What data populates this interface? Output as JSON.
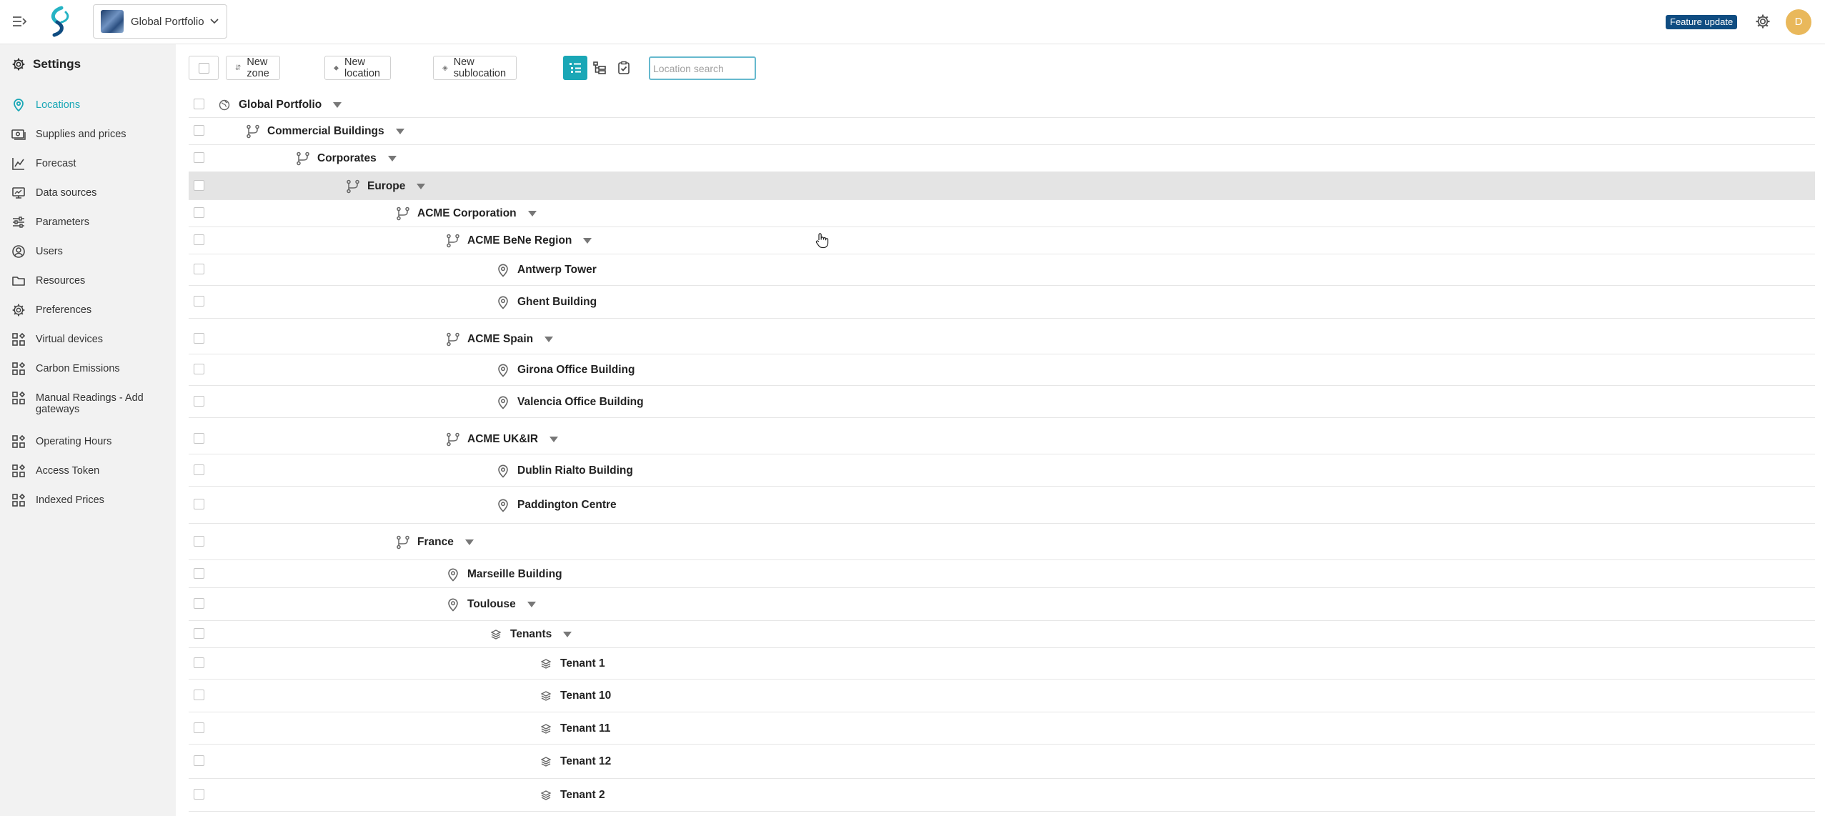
{
  "topbar": {
    "portfolio_label": "Global Portfolio",
    "feature_badge": "Feature update",
    "avatar_initial": "D"
  },
  "sidebar": {
    "title": "Settings",
    "items": [
      {
        "label": "Locations",
        "icon": "location-pin-icon",
        "active": true
      },
      {
        "label": "Supplies and prices",
        "icon": "supplies-icon"
      },
      {
        "label": "Forecast",
        "icon": "forecast-chart-icon"
      },
      {
        "label": "Data sources",
        "icon": "data-sources-icon"
      },
      {
        "label": "Parameters",
        "icon": "sliders-icon"
      },
      {
        "label": "Users",
        "icon": "user-icon"
      },
      {
        "label": "Resources",
        "icon": "folder-icon"
      },
      {
        "label": "Preferences",
        "icon": "gear-icon"
      },
      {
        "label": "Virtual devices",
        "icon": "widgets-icon"
      },
      {
        "label": "Carbon Emissions",
        "icon": "widgets-icon"
      },
      {
        "label": "Manual Readings - Add gateways",
        "icon": "widgets-icon"
      },
      {
        "label": "Operating Hours",
        "icon": "widgets-icon"
      },
      {
        "label": "Access Token",
        "icon": "widgets-icon"
      },
      {
        "label": "Indexed Prices",
        "icon": "widgets-icon"
      }
    ]
  },
  "toolbar": {
    "new_zone": "New zone",
    "new_location": "New location",
    "new_sublocation": "New sublocation",
    "search_placeholder": "Location search"
  },
  "tree": [
    {
      "label": "Global Portfolio",
      "type": "globe",
      "expandable": true
    },
    {
      "label": "Commercial Buildings",
      "type": "zone",
      "expandable": true
    },
    {
      "label": "Corporates",
      "type": "zone",
      "expandable": true
    },
    {
      "label": "Europe",
      "type": "zone",
      "expandable": true,
      "highlighted": true
    },
    {
      "label": "ACME Corporation",
      "type": "zone",
      "expandable": true
    },
    {
      "label": "ACME BeNe Region",
      "type": "zone",
      "expandable": true
    },
    {
      "label": "Antwerp Tower",
      "type": "location",
      "expandable": false
    },
    {
      "label": "Ghent Building",
      "type": "location",
      "expandable": false
    },
    {
      "label": "ACME Spain",
      "type": "zone",
      "expandable": true
    },
    {
      "label": "Girona Office Building",
      "type": "location",
      "expandable": false
    },
    {
      "label": "Valencia Office Building",
      "type": "location",
      "expandable": false
    },
    {
      "label": "ACME UK&IR",
      "type": "zone",
      "expandable": true
    },
    {
      "label": "Dublin Rialto Building",
      "type": "location",
      "expandable": false
    },
    {
      "label": "Paddington Centre",
      "type": "location",
      "expandable": false
    },
    {
      "label": "France",
      "type": "zone",
      "expandable": true
    },
    {
      "label": "Marseille Building",
      "type": "location",
      "expandable": false
    },
    {
      "label": "Toulouse",
      "type": "location",
      "expandable": true
    },
    {
      "label": "Tenants",
      "type": "sublocation",
      "expandable": true
    },
    {
      "label": "Tenant 1",
      "type": "sublocation",
      "expandable": false
    },
    {
      "label": "Tenant 10",
      "type": "sublocation",
      "expandable": false
    },
    {
      "label": "Tenant 11",
      "type": "sublocation",
      "expandable": false
    },
    {
      "label": "Tenant 12",
      "type": "sublocation",
      "expandable": false
    },
    {
      "label": "Tenant 2",
      "type": "sublocation",
      "expandable": false
    }
  ]
}
